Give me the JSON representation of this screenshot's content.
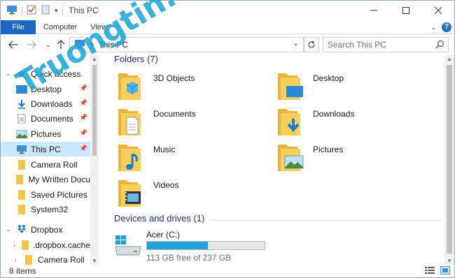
{
  "window": {
    "title": "This PC"
  },
  "ribbon": {
    "tabs": [
      "File",
      "Computer",
      "View"
    ]
  },
  "address": {
    "path": "This PC",
    "search_placeholder": "Search This PC"
  },
  "nav": {
    "items": [
      {
        "label": "Quick access",
        "icon": "star-icon",
        "pinned": false
      },
      {
        "label": "Desktop",
        "icon": "desktop-icon",
        "pinned": true
      },
      {
        "label": "Downloads",
        "icon": "download-icon",
        "pinned": true
      },
      {
        "label": "Documents",
        "icon": "document-icon",
        "pinned": true
      },
      {
        "label": "Pictures",
        "icon": "pictures-icon",
        "pinned": true
      },
      {
        "label": "This PC",
        "icon": "pc-icon",
        "pinned": true
      },
      {
        "label": "Camera Roll",
        "icon": "folder-icon",
        "pinned": false
      },
      {
        "label": "My Written Docu",
        "icon": "folder-icon",
        "pinned": false
      },
      {
        "label": "Saved Pictures",
        "icon": "folder-icon",
        "pinned": false
      },
      {
        "label": "System32",
        "icon": "folder-icon",
        "pinned": false
      },
      {
        "label": "Dropbox",
        "icon": "dropbox-icon",
        "pinned": false
      },
      {
        "label": ".dropbox.cache",
        "icon": "folder-icon",
        "pinned": false
      },
      {
        "label": "Camera Roll",
        "icon": "folder-icon",
        "pinned": false
      }
    ]
  },
  "content": {
    "folders_heading": "Folders (7)",
    "folders": [
      {
        "label": "3D Objects",
        "icon": "3d-objects-folder-icon"
      },
      {
        "label": "Desktop",
        "icon": "desktop-folder-icon"
      },
      {
        "label": "Documents",
        "icon": "documents-folder-icon"
      },
      {
        "label": "Downloads",
        "icon": "downloads-folder-icon"
      },
      {
        "label": "Music",
        "icon": "music-folder-icon"
      },
      {
        "label": "Pictures",
        "icon": "pictures-folder-icon"
      },
      {
        "label": "Videos",
        "icon": "videos-folder-icon"
      }
    ],
    "drives_heading": "Devices and drives (1)",
    "drive": {
      "name": "Acer (C:)",
      "free_text": "113 GB free of 237 GB",
      "used_fraction": 0.52
    }
  },
  "status": {
    "count": "8 items"
  },
  "watermark": "Truongtin.top",
  "colors": {
    "accent": "#1a66c4",
    "folder": "#f5c84c",
    "selected": "#cce8ff",
    "heading": "#1e3287",
    "bar": "#26a0da"
  }
}
